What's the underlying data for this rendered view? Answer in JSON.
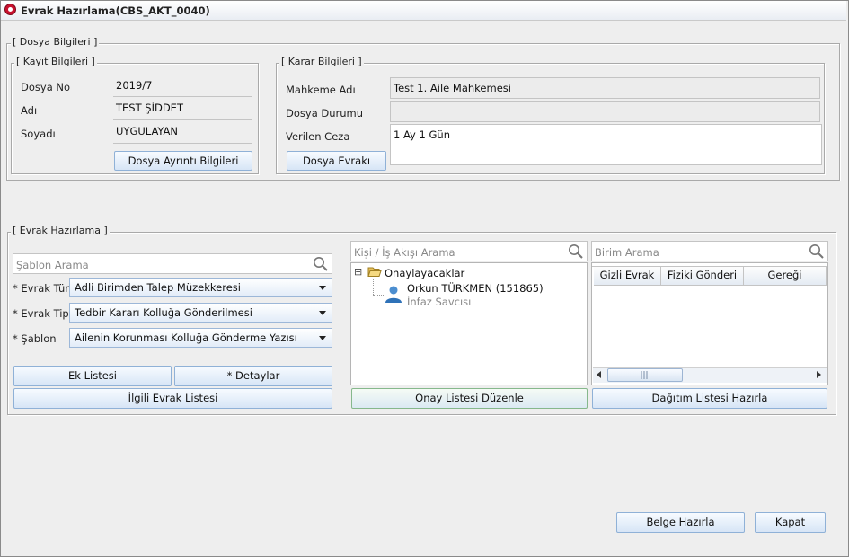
{
  "window": {
    "title": "Evrak Hazırlama(CBS_AKT_0040)"
  },
  "dosya_bilgileri": {
    "legend": "[ Dosya Bilgileri ]",
    "kayit": {
      "legend": "[ Kayıt Bilgileri ]",
      "dosya_no_label": "Dosya No",
      "dosya_no_value": "2019/7",
      "adi_label": "Adı",
      "adi_value": "TEST ŞİDDET",
      "soyadi_label": "Soyadı",
      "soyadi_value": "UYGULAYAN",
      "detail_button": "Dosya Ayrıntı Bilgileri"
    },
    "karar": {
      "legend": "[ Karar Bilgileri ]",
      "mahkeme_label": "Mahkeme Adı",
      "mahkeme_value": "Test 1. Aile Mahkemesi",
      "durum_label": "Dosya Durumu",
      "durum_value": "",
      "ceza_label": "Verilen Ceza",
      "ceza_value": "1 Ay 1 Gün",
      "evrak_button": "Dosya Evrakı"
    }
  },
  "evrak_hazirlama": {
    "legend": "[ Evrak Hazırlama ]",
    "sablon_search_placeholder": "Şablon Arama",
    "evrak_turu_label": "* Evrak Türü",
    "evrak_turu_value": "Adli Birimden Talep Müzekkeresi",
    "evrak_tipi_label": "* Evrak Tipi",
    "evrak_tipi_value": "Tedbir Kararı Kolluğa Gönderilmesi",
    "sablon_label": "* Şablon",
    "sablon_value": "Ailenin Korunması Kolluğa Gönderme Yazısı",
    "ek_listesi_button": "Ek Listesi",
    "detaylar_button": "* Detaylar",
    "ilgili_evrak_button": "İlgili Evrak Listesi",
    "kisi_search_placeholder": "Kişi / İş Akışı Arama",
    "tree": {
      "root_toggle": "⊟",
      "root_label": "Onaylayacaklar",
      "person_name": "Orkun TÜRKMEN (151865)",
      "person_role": "İnfaz Savcısı"
    },
    "onay_button": "Onay Listesi Düzenle",
    "birim_search_placeholder": "Birim Arama",
    "table_headers": [
      "Gizli Evrak",
      "Fiziki Gönderi",
      "Gereği"
    ],
    "table_rows": [],
    "dagitim_button": "Dağıtım Listesi Hazırla"
  },
  "footer": {
    "belge_button": "Belge Hazırla",
    "kapat_button": "Kapat"
  },
  "colors": {
    "accent_border": "#8fb1d7",
    "title_icon": "#c8102e"
  }
}
